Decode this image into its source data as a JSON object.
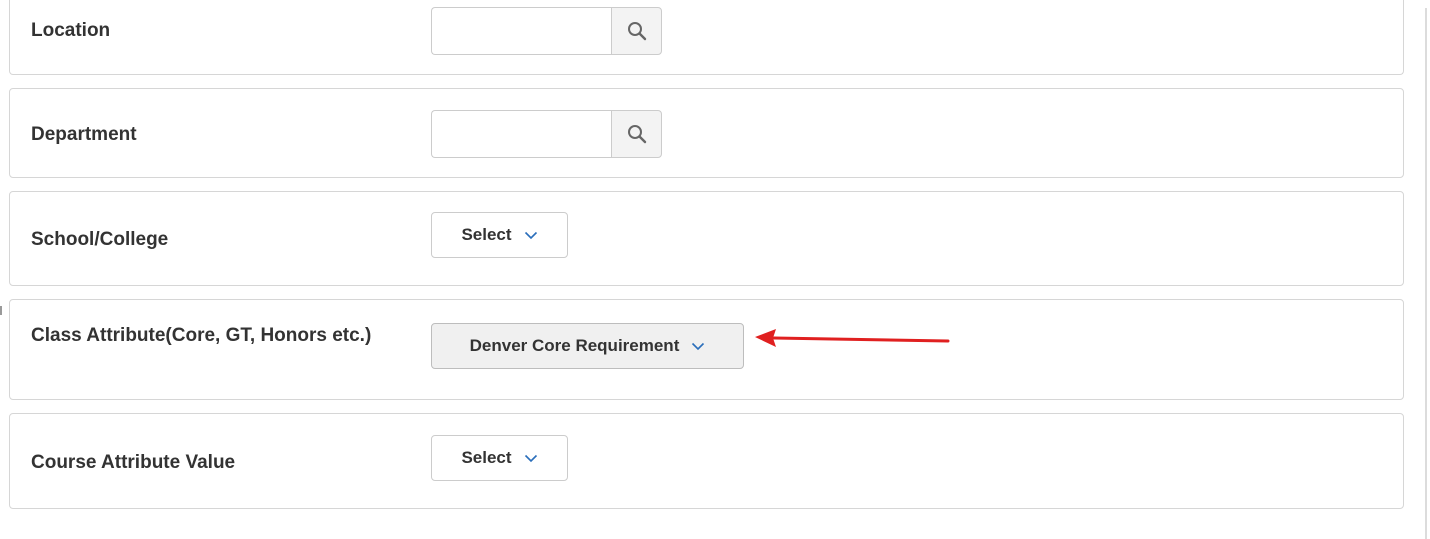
{
  "filters": {
    "location": {
      "label": "Location"
    },
    "department": {
      "label": "Department"
    },
    "school_college": {
      "label": "School/College",
      "value": "Select"
    },
    "class_attribute": {
      "label": "Class Attribute(Core, GT, Honors etc.)",
      "value": "Denver Core Requirement"
    },
    "course_attribute_value": {
      "label": "Course Attribute Value",
      "value": "Select"
    }
  },
  "icons": {
    "search": "search-icon",
    "dropdown": "chevron-down-icon",
    "annotation": "arrow-left-icon"
  },
  "colors": {
    "accent_blue": "#2a6ebb",
    "annotation_red": "#e02020",
    "panel_border": "#d6d6d6"
  }
}
